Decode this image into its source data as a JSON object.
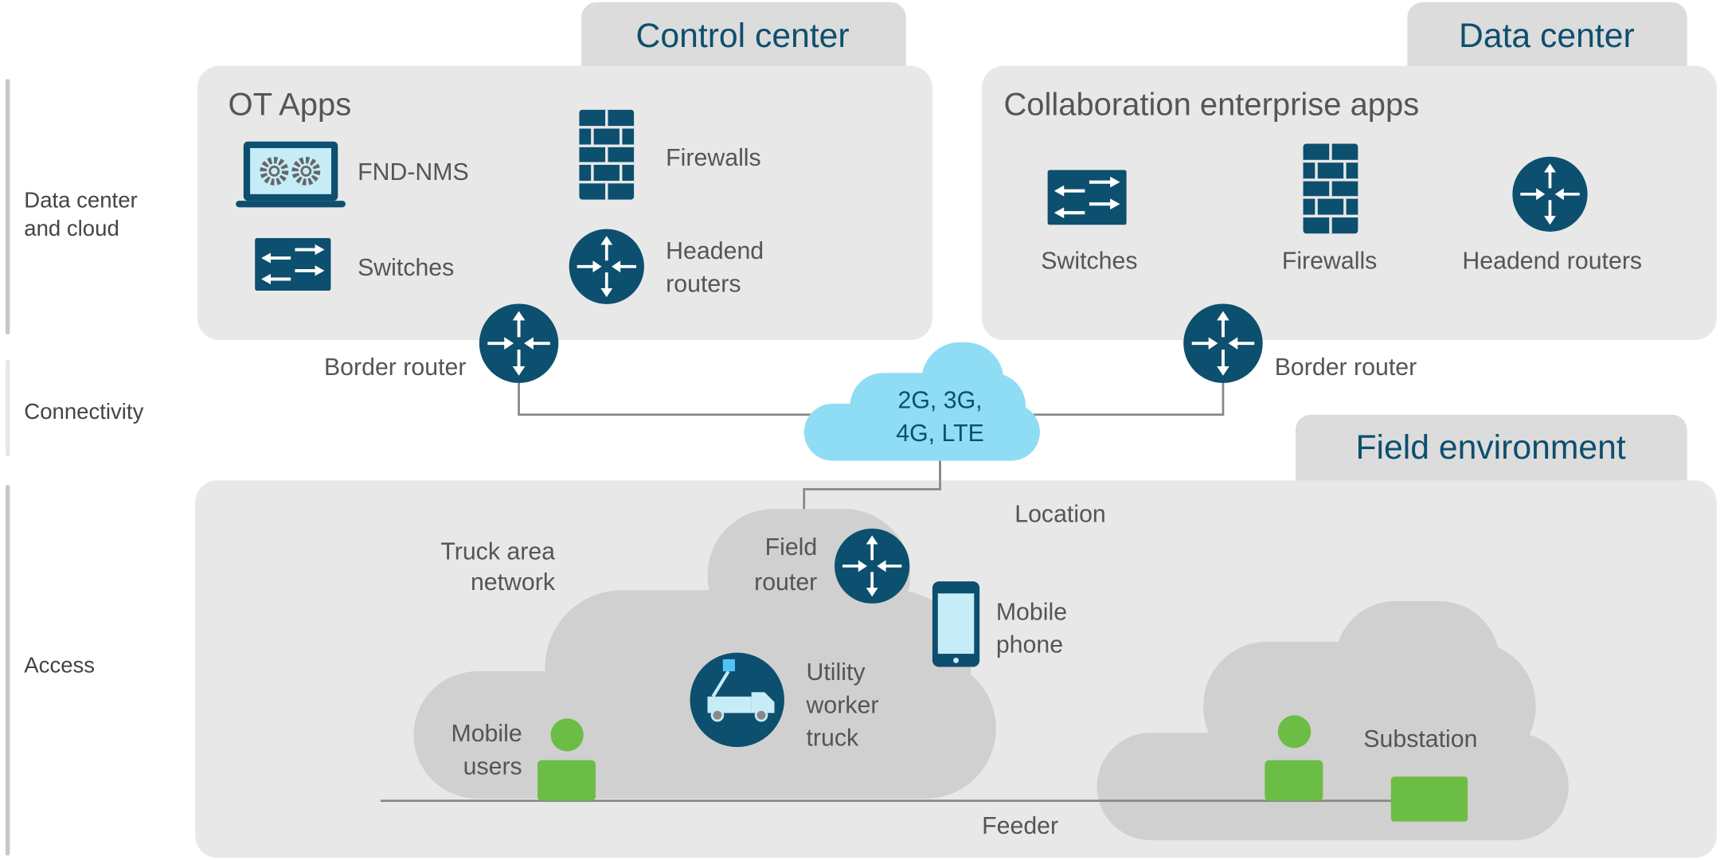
{
  "side_labels": {
    "data_center_line1": "Data center",
    "data_center_line2": "and cloud",
    "connectivity": "Connectivity",
    "access": "Access"
  },
  "control_center": {
    "tab": "Control center",
    "title": "OT Apps",
    "fnd_nms": "FND-NMS",
    "firewalls": "Firewalls",
    "switches": "Switches",
    "headend_line1": "Headend",
    "headend_line2": "routers",
    "border_router": "Border router"
  },
  "data_center": {
    "tab": "Data center",
    "title": "Collaboration enterprise apps",
    "switches": "Switches",
    "firewalls": "Firewalls",
    "headend": "Headend routers",
    "border_router": "Border router"
  },
  "cellular_cloud": {
    "line1": "2G, 3G,",
    "line2": "4G, LTE"
  },
  "field": {
    "tab": "Field environment",
    "location": "Location",
    "truck_area_line1": "Truck area",
    "truck_area_line2": "network",
    "field_router_line1": "Field",
    "field_router_line2": "router",
    "mobile_phone_line1": "Mobile",
    "mobile_phone_line2": "phone",
    "truck_line1": "Utility",
    "truck_line2": "worker",
    "truck_line3": "truck",
    "mobile_users_line1": "Mobile",
    "mobile_users_line2": "users",
    "substation": "Substation",
    "feeder": "Feeder"
  },
  "colors": {
    "icon_blue": "#0d4f6e",
    "cloud_cyan": "#8fdcf5",
    "green": "#6cbd45",
    "panel_gray": "#e8e8e8",
    "tab_gray": "#dcdcdc"
  }
}
